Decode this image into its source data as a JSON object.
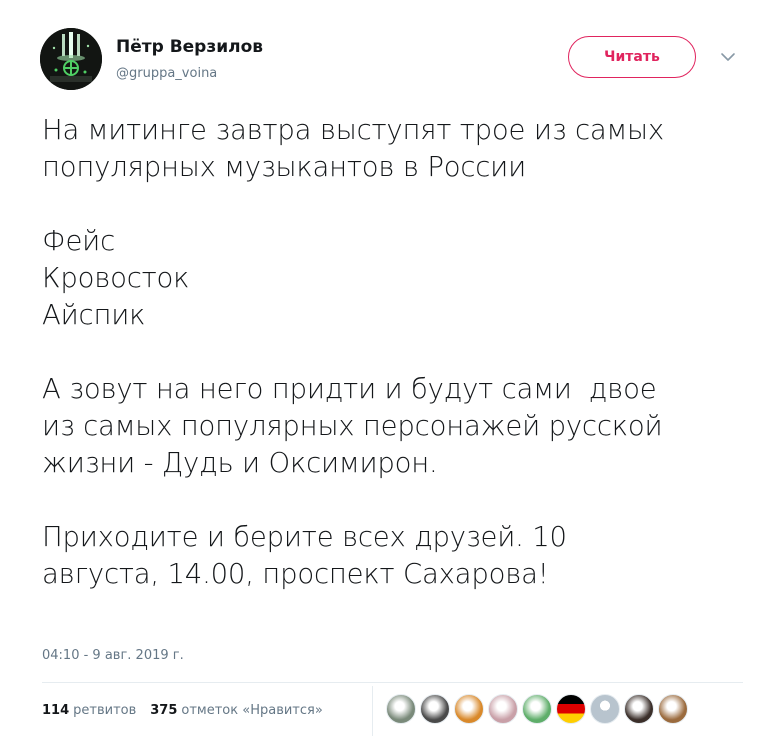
{
  "author": {
    "name": "Пётр Верзилов",
    "handle": "@gruppa_voina"
  },
  "follow_button": {
    "label": "Читать"
  },
  "menu": {
    "icon": "chevron-down-icon"
  },
  "tweet": {
    "lines": [
      "На митинге завтра выступят трое из самых",
      "популярных музыкантов в России",
      "",
      "Фейс",
      "Кровосток",
      "Айспик",
      "",
      "А зовут на него придти и будут сами  двое",
      "из самых популярных персонажей русской",
      "жизни - Дудь и Оксимирон.",
      "",
      "Приходите и берите всех друзей. 10",
      "августа, 14.00, проспект Сахарова!"
    ],
    "timestamp": "04:10 - 9 авг. 2019 г."
  },
  "stats": {
    "retweets_count": "114",
    "retweets_label": "ретвитов",
    "likes_count": "375",
    "likes_label": "отметок «Нравится»"
  },
  "likers": [
    {
      "icon": "liker-avatar-person",
      "color": "#7a8a7a"
    },
    {
      "icon": "liker-avatar-cat",
      "color": "#4a4a4a"
    },
    {
      "icon": "liker-avatar-tiger",
      "color": "#d9892b"
    },
    {
      "icon": "liker-avatar-badge",
      "color": "#c9a0a8"
    },
    {
      "icon": "liker-avatar-green",
      "color": "#5fae6a"
    },
    {
      "icon": "liker-avatar-germany",
      "color": "#dd0000"
    },
    {
      "icon": "liker-avatar-default",
      "color": "#b8c4ce"
    },
    {
      "icon": "liker-avatar-dark",
      "color": "#3b2f2a"
    },
    {
      "icon": "liker-avatar-animal",
      "color": "#9b6b3e"
    }
  ]
}
